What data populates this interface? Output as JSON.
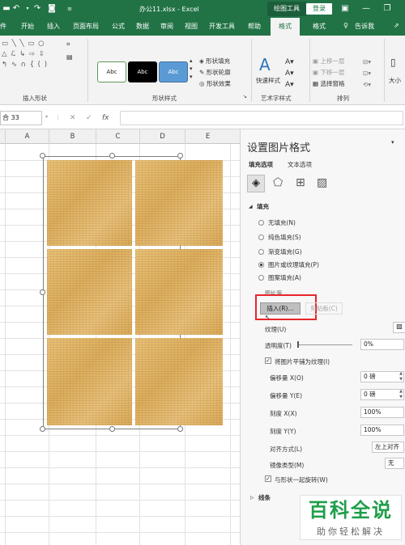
{
  "titlebar": {
    "filename": "办公11.xlsx - Excel",
    "contextual_tab_title": "绘图工具",
    "login_label": "登录"
  },
  "tabs": [
    "件",
    "开始",
    "插入",
    "页面布局",
    "公式",
    "数据",
    "审阅",
    "视图",
    "开发工具",
    "帮助",
    "格式",
    "格式"
  ],
  "tell_me": "告诉我",
  "ribbon": {
    "insert_shapes_label": "插入形状",
    "shape_styles_label": "形状样式",
    "style_sample": "Abc",
    "shape_fill": "形状填充",
    "shape_outline": "形状轮廓",
    "shape_effects": "形状效果",
    "quick_styles": "快速样式",
    "wordart_label": "艺术字样式",
    "bring_forward": "上移一层",
    "send_backward": "下移一层",
    "selection_pane": "选择窗格",
    "arrange_label": "排列",
    "size_label": "大小"
  },
  "formula_bar": {
    "name_box": "合 33",
    "formula": ""
  },
  "columns": [
    "A",
    "B",
    "C",
    "D",
    "E"
  ],
  "pane": {
    "title": "设置图片格式",
    "tab_fill_line": "填充选项",
    "tab_text": "文本选项",
    "section_fill": "填充",
    "opt_no_fill": "无填充(N)",
    "opt_solid": "纯色填充(S)",
    "opt_gradient": "渐变填充(G)",
    "opt_picture": "图片或纹理填充(P)",
    "opt_pattern": "图案填充(A)",
    "picture_source": "图片源",
    "insert_button": "插入(R)...",
    "clipboard_button": "剪贴板(C)",
    "texture_label": "纹理(U)",
    "transparency_label": "透明度(T)",
    "transparency_value": "0%",
    "tile_label": "将图片平铺为纹理(I)",
    "offset_x_label": "偏移量 X(O)",
    "offset_x_value": "0 磅",
    "offset_y_label": "偏移量 Y(E)",
    "offset_y_value": "0 磅",
    "scale_x_label": "刻度 X(X)",
    "scale_x_value": "100%",
    "scale_y_label": "刻度 Y(Y)",
    "scale_y_value": "100%",
    "alignment_label": "对齐方式(L)",
    "alignment_value": "左上对齐",
    "mirror_label": "镜像类型(M)",
    "mirror_value": "无",
    "rotate_label": "与形状一起旋转(W)",
    "section_line": "线条"
  },
  "watermark": {
    "title": "百科全说",
    "subtitle": "助你轻松解决"
  },
  "colors": {
    "excel_green": "#217346",
    "highlight_red": "#e8262a"
  }
}
